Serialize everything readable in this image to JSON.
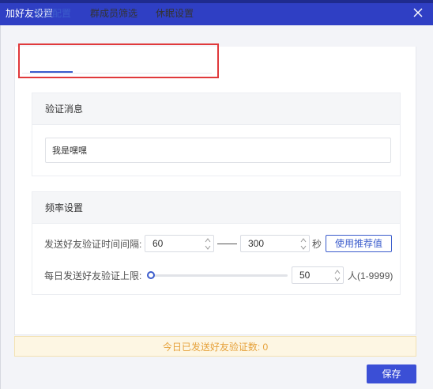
{
  "window": {
    "title": "加好友设置",
    "close_icon": "close-icon"
  },
  "tabs": [
    {
      "label": "发送配置",
      "active": true
    },
    {
      "label": "群成员筛选",
      "active": false
    },
    {
      "label": "休眠设置",
      "active": false
    }
  ],
  "verify": {
    "title": "验证消息",
    "message": "我是嘿嘿"
  },
  "frequency": {
    "title": "频率设置",
    "interval_label": "发送好友验证时间间隔:",
    "interval_min": "60",
    "interval_max": "300",
    "interval_unit": "秒",
    "recommend_button": "使用推荐值",
    "daily_limit_label": "每日发送好友验证上限:",
    "daily_limit_value": "50",
    "daily_limit_unit": "人(1-9999)",
    "slider_fraction": 0.005
  },
  "banner": {
    "text": "今日已发送好友验证数:  0"
  },
  "footer": {
    "save_label": "保存"
  },
  "colors": {
    "titlebar": "#2f3fc4",
    "accent": "#3b5ccc",
    "highlight_box": "#e0393b",
    "banner_text": "#e6a23c"
  }
}
